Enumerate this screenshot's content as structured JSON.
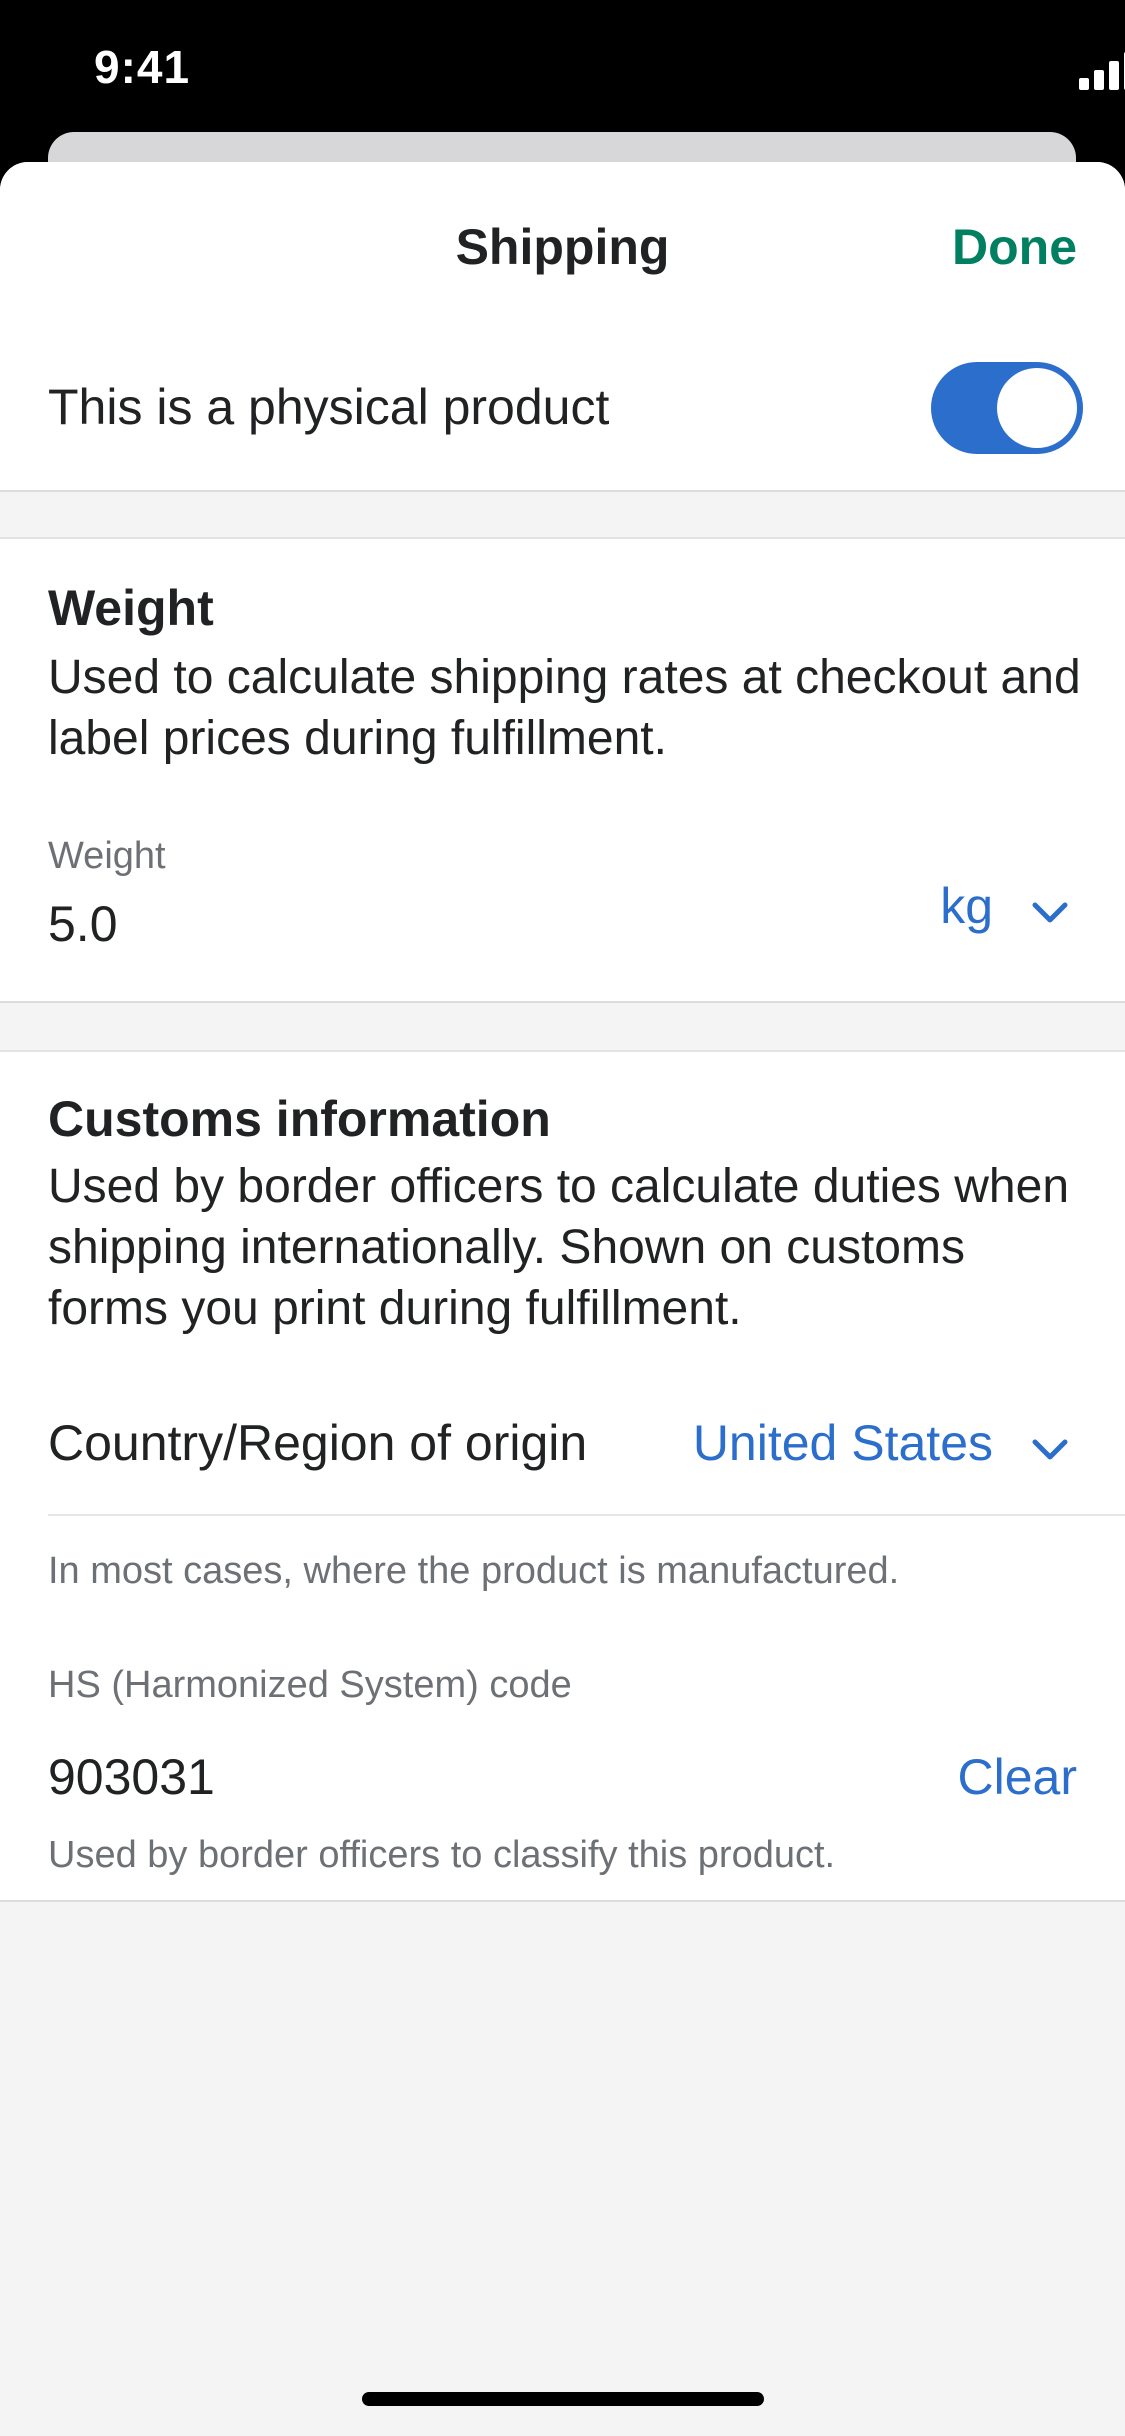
{
  "status_bar": {
    "time": "9:41",
    "icons": [
      "signal-icon",
      "wifi-icon",
      "battery-icon"
    ]
  },
  "header": {
    "title": "Shipping",
    "done_label": "Done",
    "done_color": "#008060"
  },
  "physical_product": {
    "label": "This is a physical product",
    "toggle_on": true,
    "toggle_color": "#2c6ecb"
  },
  "weight": {
    "title": "Weight",
    "description": "Used to calculate shipping rates at checkout and label prices during fulfillment.",
    "field_label": "Weight",
    "value": "5.0",
    "unit": "kg"
  },
  "customs": {
    "title": "Customs information",
    "description": "Used by border officers to calculate duties when shipping internationally. Shown on customs forms you print during fulfillment.",
    "origin_label": "Country/Region of origin",
    "origin_value": "United States",
    "origin_help": "In most cases, where the product is manufactured.",
    "hs_label": "HS (Harmonized System) code",
    "hs_value": "903031",
    "hs_clear": "Clear",
    "hs_help": "Used by border officers to classify this product."
  },
  "accent_color": "#2c6ecb"
}
